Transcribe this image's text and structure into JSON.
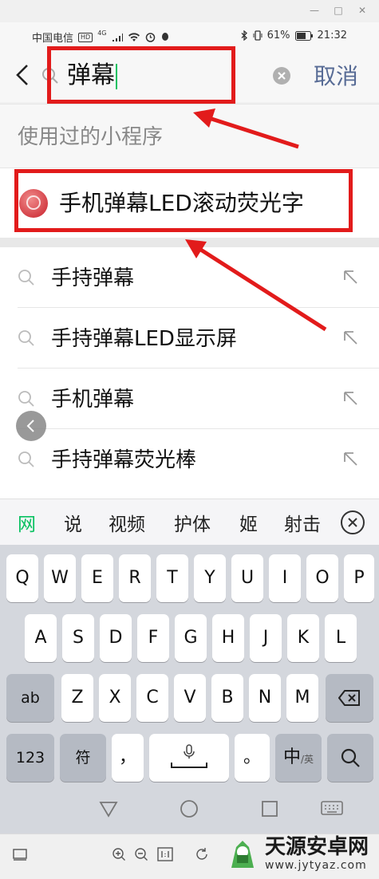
{
  "status_bar": {
    "carrier": "中国电信",
    "hd": "HD",
    "network": "4G",
    "battery_percent": "61%",
    "time": "21:32"
  },
  "search": {
    "query": "弹幕",
    "cancel_label": "取消"
  },
  "section_title": "使用过的小程序",
  "mini_program": {
    "label": "手机弹幕LED滚动荧光字"
  },
  "suggestions": [
    {
      "text": "手持弹幕"
    },
    {
      "text": "手持弹幕LED显示屏"
    },
    {
      "text": "手机弹幕"
    },
    {
      "text": "手持弹幕荧光棒"
    }
  ],
  "candidates": [
    "网",
    "说",
    "视频",
    "护体",
    "姬",
    "射击"
  ],
  "keyboard": {
    "row1": [
      "Q",
      "W",
      "E",
      "R",
      "T",
      "Y",
      "U",
      "I",
      "O",
      "P"
    ],
    "row2": [
      "A",
      "S",
      "D",
      "F",
      "G",
      "H",
      "J",
      "K",
      "L"
    ],
    "row3": [
      "Z",
      "X",
      "C",
      "V",
      "B",
      "N",
      "M"
    ],
    "abc_label": "ab",
    "num_label": "123",
    "symbol_label": "符",
    "comma_label": "，",
    "period_label": "。",
    "lang_label": "中",
    "lang_sub": "/英"
  },
  "watermark": {
    "title": "天源安卓网",
    "url": "www.jytyaz.com"
  },
  "colors": {
    "accent_green": "#07c160",
    "link_blue": "#576b95",
    "annotation_red": "#e21b1b"
  }
}
